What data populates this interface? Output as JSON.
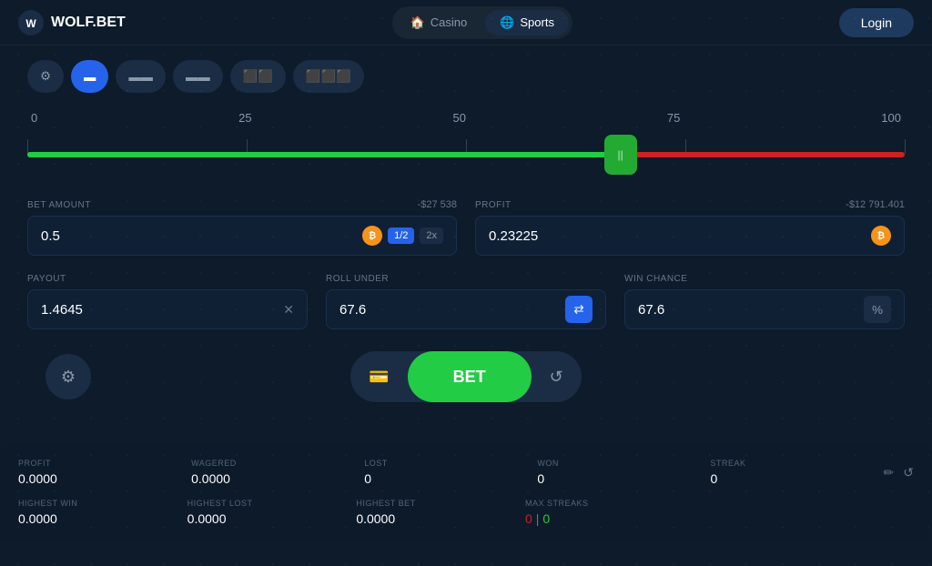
{
  "header": {
    "logo_text": "WOLF.BET",
    "nav_casino": "Casino",
    "nav_sports": "Sports",
    "login_label": "Login"
  },
  "toolbar": {
    "icons": [
      "⚙",
      "⬛",
      "⬛",
      "⬛",
      "⬛",
      "⬛"
    ]
  },
  "slider": {
    "labels": [
      "0",
      "25",
      "50",
      "75",
      "100"
    ],
    "handle_icon": "||",
    "position_pct": 67.6
  },
  "bet_amount": {
    "label": "BET AMOUNT",
    "sub": "-$27 538",
    "value": "0.5",
    "half_label": "1/2",
    "double_label": "2x"
  },
  "profit": {
    "label": "PROFIT",
    "sub": "-$12 791.401",
    "value": "0.23225"
  },
  "payout": {
    "label": "PAYOUT",
    "value": "1.4645"
  },
  "roll_under": {
    "label": "ROLL UNDER",
    "value": "67.6"
  },
  "win_chance": {
    "label": "WIN CHANCE",
    "value": "67.6"
  },
  "bet_button": {
    "label": "BET"
  },
  "stats": {
    "profit_label": "PROFIT",
    "profit_value": "0.0000",
    "wagered_label": "WAGERED",
    "wagered_value": "0.0000",
    "lost_label": "LOST",
    "lost_value": "0",
    "won_label": "WON",
    "won_value": "0",
    "streak_label": "STREAK",
    "streak_value": "0",
    "highest_win_label": "HIGHEST WIN",
    "highest_win_value": "0.0000",
    "highest_lost_label": "HIGHEST LOST",
    "highest_lost_value": "0.0000",
    "highest_bet_label": "HIGHEST BET",
    "highest_bet_value": "0.0000",
    "max_streaks_label": "MAX STREAKS",
    "max_streaks_loss": "0",
    "max_streaks_win": "0"
  }
}
